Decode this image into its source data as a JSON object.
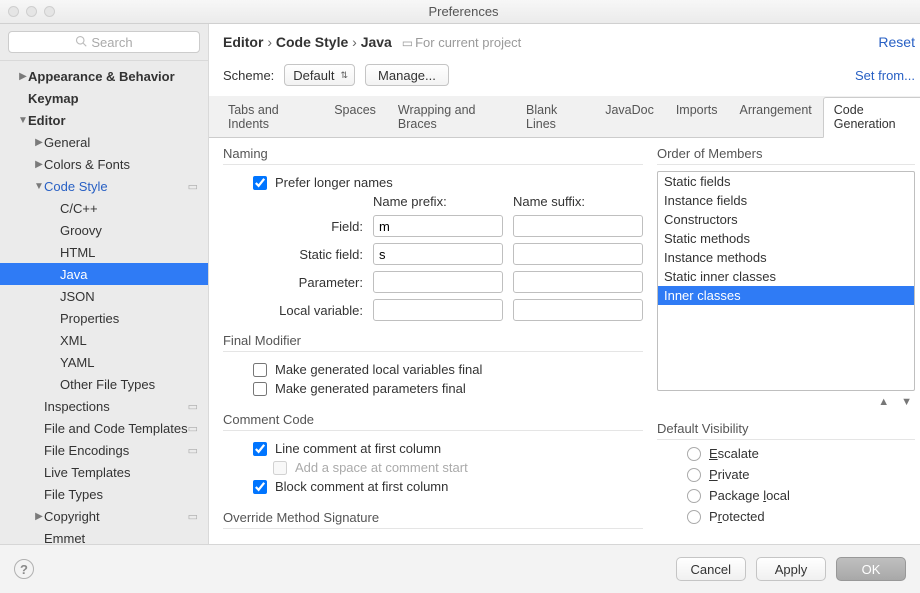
{
  "window": {
    "title": "Preferences"
  },
  "sidebar": {
    "search_placeholder": "Search",
    "items": {
      "appearance": "Appearance & Behavior",
      "keymap": "Keymap",
      "editor": "Editor",
      "general": "General",
      "colors": "Colors & Fonts",
      "codestyle": "Code Style",
      "cpp": "C/C++",
      "groovy": "Groovy",
      "html": "HTML",
      "java": "Java",
      "json": "JSON",
      "properties": "Properties",
      "xml": "XML",
      "yaml": "YAML",
      "otherfiles": "Other File Types",
      "inspections": "Inspections",
      "templates": "File and Code Templates",
      "encodings": "File Encodings",
      "livetpl": "Live Templates",
      "filetypes": "File Types",
      "copyright": "Copyright",
      "emmet": "Emmet"
    }
  },
  "header": {
    "crumb1": "Editor",
    "crumb2": "Code Style",
    "crumb3": "Java",
    "forproject": "For current project",
    "reset": "Reset"
  },
  "scheme": {
    "label": "Scheme:",
    "value": "Default",
    "manage": "Manage...",
    "setfrom": "Set from..."
  },
  "tabs": {
    "t0": "Tabs and Indents",
    "t1": "Spaces",
    "t2": "Wrapping and Braces",
    "t3": "Blank Lines",
    "t4": "JavaDoc",
    "t5": "Imports",
    "t6": "Arrangement",
    "t7": "Code Generation"
  },
  "naming": {
    "legend": "Naming",
    "prefer": "Prefer longer names",
    "hprefix": "Name prefix:",
    "hsuffix": "Name suffix:",
    "field": "Field:",
    "field_prefix": "m",
    "static": "Static field:",
    "static_prefix": "s",
    "param": "Parameter:",
    "local": "Local variable:"
  },
  "final": {
    "legend": "Final Modifier",
    "vars": "Make generated local variables final",
    "params": "Make generated parameters final"
  },
  "comment": {
    "legend": "Comment Code",
    "line": "Line comment at first column",
    "space": "Add a space at comment start",
    "block": "Block comment at first column"
  },
  "override": {
    "legend": "Override Method Signature"
  },
  "order": {
    "legend": "Order of Members",
    "i0": "Static fields",
    "i1": "Instance fields",
    "i2": "Constructors",
    "i3": "Static methods",
    "i4": "Instance methods",
    "i5": "Static inner classes",
    "i6": "Inner classes"
  },
  "visibility": {
    "legend": "Default Visibility",
    "escalate": "scalate",
    "escalate_u": "E",
    "private": "rivate",
    "private_u": "P",
    "pkg": "Package ",
    "pkg_u": "l",
    "pkg2": "ocal",
    "protected": "P",
    "protected_u": "r",
    "protected2": "otected"
  },
  "buttons": {
    "cancel": "Cancel",
    "apply": "Apply",
    "ok": "OK"
  }
}
